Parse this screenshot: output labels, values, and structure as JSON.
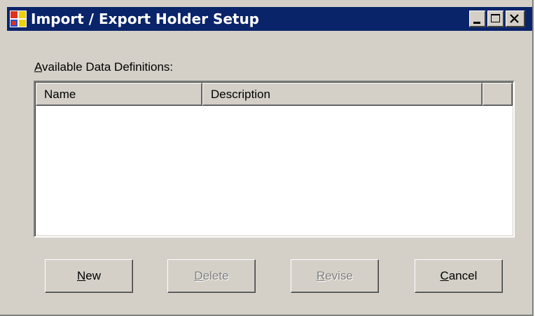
{
  "window": {
    "title": "Import / Export Holder Setup",
    "icon": "app-window-icon",
    "controls": [
      "minimize-icon",
      "maximize-icon",
      "close-icon"
    ]
  },
  "list": {
    "label_mnemonic": "A",
    "label_rest": "vailable Data Definitions:",
    "columns": [
      "Name",
      "Description"
    ],
    "rows": []
  },
  "buttons": {
    "new": {
      "mnemonic": "N",
      "rest": "ew",
      "enabled": true
    },
    "delete": {
      "mnemonic": "D",
      "rest": "elete",
      "enabled": false
    },
    "revise": {
      "mnemonic": "R",
      "rest": "evise",
      "enabled": false
    },
    "cancel": {
      "mnemonic": "C",
      "rest": "ancel",
      "enabled": true
    }
  },
  "colors": {
    "title_bar": "#0a246a",
    "face": "#d4d0c8",
    "disabled_text": "#808080"
  }
}
